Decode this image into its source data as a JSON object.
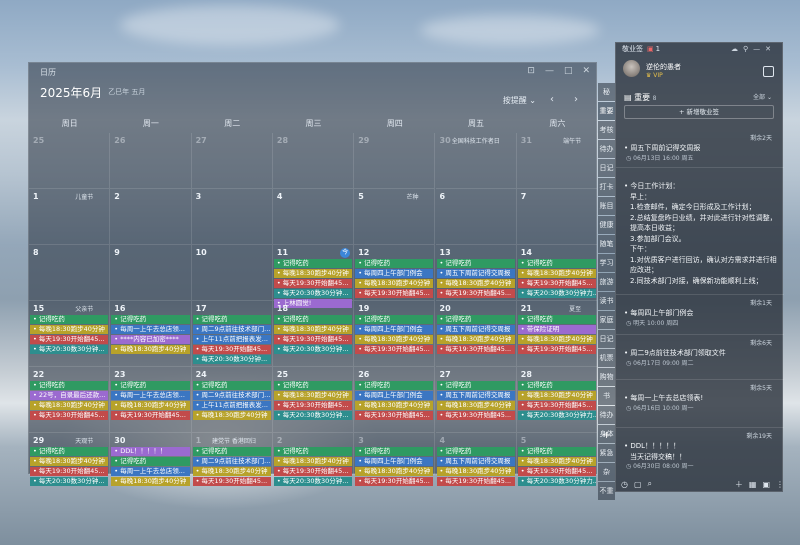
{
  "calendar": {
    "window_title": "日历",
    "month": "2025年6月",
    "lunar": "乙巳年 五月",
    "mode": "按提醒",
    "weekdays": [
      "周日",
      "周一",
      "周二",
      "周三",
      "周四",
      "周五",
      "周六"
    ],
    "rows": [
      {
        "days": [
          {
            "d": "25",
            "dim": true
          },
          {
            "d": "26",
            "dim": true
          },
          {
            "d": "27",
            "dim": true
          },
          {
            "d": "28",
            "dim": true
          },
          {
            "d": "29",
            "dim": true
          },
          {
            "d": "30",
            "dim": true,
            "holiday": "全国科技工作者日"
          },
          {
            "d": "31",
            "dim": true,
            "holiday": "端午节"
          }
        ]
      },
      {
        "days": [
          {
            "d": "1",
            "holiday": "儿童节"
          },
          {
            "d": "2"
          },
          {
            "d": "3"
          },
          {
            "d": "4"
          },
          {
            "d": "5",
            "holiday": "芒种"
          },
          {
            "d": "6"
          },
          {
            "d": "7"
          }
        ]
      },
      {
        "days": [
          {
            "d": "8"
          },
          {
            "d": "9"
          },
          {
            "d": "10"
          },
          {
            "d": "11",
            "today": "今",
            "events": [
              {
                "t": "记得吃药",
                "c": "green"
              },
              {
                "t": "每晚18:30跑步40分钟",
                "c": "yellow"
              },
              {
                "t": "每天19:30开始翻45...",
                "c": "red"
              },
              {
                "t": "每天20:30数30分钟...",
                "c": "teal"
              },
              {
                "t": "上林圆觉!",
                "c": "purple"
              }
            ]
          },
          {
            "d": "12",
            "events": [
              {
                "t": "记得吃药",
                "c": "green"
              },
              {
                "t": "每周四上午部门例会",
                "c": "blue"
              },
              {
                "t": "每晚18:30跑步40分钟",
                "c": "yellow"
              },
              {
                "t": "每天19:30开始翻45...",
                "c": "red"
              }
            ]
          },
          {
            "d": "13",
            "events": [
              {
                "t": "记得吃药",
                "c": "green"
              },
              {
                "t": "周五下周前记得交周报",
                "c": "blue"
              },
              {
                "t": "每晚18:30跑步40分钟",
                "c": "yellow"
              },
              {
                "t": "每天19:30开始翻45...",
                "c": "red"
              }
            ]
          },
          {
            "d": "14",
            "events": [
              {
                "t": "记得吃药",
                "c": "green"
              },
              {
                "t": "每晚18:30跑步40分钟",
                "c": "yellow"
              },
              {
                "t": "每天19:30开始翻45...",
                "c": "red"
              },
              {
                "t": "每天20:30数30分钟力...",
                "c": "teal"
              }
            ]
          }
        ]
      },
      {
        "days": [
          {
            "d": "15",
            "holiday": "父亲节",
            "events": [
              {
                "t": "记得吃药",
                "c": "green"
              },
              {
                "t": "每晚18:30跑步40分钟",
                "c": "yellow"
              },
              {
                "t": "每天19:30开始翻45...",
                "c": "red"
              },
              {
                "t": "每天20:30数30分钟...",
                "c": "teal"
              }
            ]
          },
          {
            "d": "16",
            "events": [
              {
                "t": "记得吃药",
                "c": "green"
              },
              {
                "t": "每周一上午去总店领...",
                "c": "blue"
              },
              {
                "t": "****内容已加密****",
                "c": "purple"
              },
              {
                "t": "每晚18:30跑步40分钟",
                "c": "yellow"
              }
            ]
          },
          {
            "d": "17",
            "events": [
              {
                "t": "记得吃药",
                "c": "green"
              },
              {
                "t": "周二9点前往技术部门...",
                "c": "blue"
              },
              {
                "t": "上午11点前把报表发...",
                "c": "blue"
              },
              {
                "t": "每天19:30开始翻45...",
                "c": "red"
              },
              {
                "t": "每天20:30数30分钟...",
                "c": "teal"
              }
            ]
          },
          {
            "d": "18",
            "events": [
              {
                "t": "记得吃药",
                "c": "green"
              },
              {
                "t": "每晚18:30跑步40分钟",
                "c": "yellow"
              },
              {
                "t": "每天19:30开始翻45...",
                "c": "red"
              },
              {
                "t": "每天20:30数30分钟...",
                "c": "teal"
              }
            ]
          },
          {
            "d": "19",
            "events": [
              {
                "t": "记得吃药",
                "c": "green"
              },
              {
                "t": "每周四上午部门例会",
                "c": "blue"
              },
              {
                "t": "每晚18:30跑步40分钟",
                "c": "yellow"
              },
              {
                "t": "每天19:30开始翻45...",
                "c": "red"
              }
            ]
          },
          {
            "d": "20",
            "events": [
              {
                "t": "记得吃药",
                "c": "green"
              },
              {
                "t": "周五下周前记得交周报",
                "c": "blue"
              },
              {
                "t": "每晚18:30跑步40分钟",
                "c": "yellow"
              },
              {
                "t": "每天19:30开始翻45...",
                "c": "red"
              }
            ]
          },
          {
            "d": "21",
            "holiday": "夏至",
            "events": [
              {
                "t": "记得吃药",
                "c": "green"
              },
              {
                "t": "带保险证明",
                "c": "purple"
              },
              {
                "t": "每晚18:30跑步40分钟",
                "c": "yellow"
              },
              {
                "t": "每天19:30开始翻45...",
                "c": "red"
              }
            ]
          }
        ]
      },
      {
        "days": [
          {
            "d": "22",
            "events": [
              {
                "t": "记得吃药",
                "c": "green"
              },
              {
                "t": "22号，自录最后还款...",
                "c": "purple"
              },
              {
                "t": "每晚18:30跑步40分钟",
                "c": "yellow"
              },
              {
                "t": "每天19:30开始翻45...",
                "c": "red"
              }
            ]
          },
          {
            "d": "23",
            "events": [
              {
                "t": "记得吃药",
                "c": "green"
              },
              {
                "t": "每周一上午去总店领...",
                "c": "blue"
              },
              {
                "t": "每晚18:30跑步40分钟",
                "c": "yellow"
              },
              {
                "t": "每天19:30开始翻45...",
                "c": "red"
              }
            ]
          },
          {
            "d": "24",
            "events": [
              {
                "t": "记得吃药",
                "c": "green"
              },
              {
                "t": "周二9点前往技术部门...",
                "c": "blue"
              },
              {
                "t": "上午11点前把报表发...",
                "c": "blue"
              },
              {
                "t": "每晚18:30跑步40分钟",
                "c": "yellow"
              }
            ]
          },
          {
            "d": "25",
            "events": [
              {
                "t": "记得吃药",
                "c": "green"
              },
              {
                "t": "每晚18:30跑步40分钟",
                "c": "yellow"
              },
              {
                "t": "每天19:30开始翻45...",
                "c": "red"
              },
              {
                "t": "每天20:30数30分钟...",
                "c": "teal"
              }
            ]
          },
          {
            "d": "26",
            "events": [
              {
                "t": "记得吃药",
                "c": "green"
              },
              {
                "t": "每周四上午部门例会",
                "c": "blue"
              },
              {
                "t": "每晚18:30跑步40分钟",
                "c": "yellow"
              },
              {
                "t": "每天19:30开始翻45...",
                "c": "red"
              }
            ]
          },
          {
            "d": "27",
            "events": [
              {
                "t": "记得吃药",
                "c": "green"
              },
              {
                "t": "周五下周前记得交周报",
                "c": "blue"
              },
              {
                "t": "每晚18:30跑步40分钟",
                "c": "yellow"
              },
              {
                "t": "每天19:30开始翻45...",
                "c": "red"
              }
            ]
          },
          {
            "d": "28",
            "events": [
              {
                "t": "记得吃药",
                "c": "green"
              },
              {
                "t": "每晚18:30跑步40分钟",
                "c": "yellow"
              },
              {
                "t": "每天19:30开始翻45...",
                "c": "red"
              },
              {
                "t": "每天20:30数30分钟力...",
                "c": "teal"
              }
            ]
          }
        ]
      },
      {
        "days": [
          {
            "d": "29",
            "holiday": "天观节",
            "events": [
              {
                "t": "记得吃药",
                "c": "green"
              },
              {
                "t": "每晚18:30跑步40分钟",
                "c": "yellow"
              },
              {
                "t": "每天19:30开始翻45...",
                "c": "red"
              },
              {
                "t": "每天20:30数30分钟...",
                "c": "teal"
              }
            ]
          },
          {
            "d": "30",
            "events": [
              {
                "t": "DDL！！！！！",
                "c": "purple"
              },
              {
                "t": "记得吃药",
                "c": "green"
              },
              {
                "t": "每周一上午去总店领...",
                "c": "blue"
              },
              {
                "t": "每晚18:30跑步40分钟",
                "c": "yellow"
              }
            ]
          },
          {
            "d": "1",
            "dim": true,
            "holiday": "建党节 香港回归",
            "events": [
              {
                "t": "记得吃药",
                "c": "green"
              },
              {
                "t": "周二9点前往技术部门...",
                "c": "blue"
              },
              {
                "t": "每晚18:30跑步40分钟",
                "c": "yellow"
              },
              {
                "t": "每天19:30开始翻45...",
                "c": "red"
              }
            ]
          },
          {
            "d": "2",
            "dim": true,
            "events": [
              {
                "t": "记得吃药",
                "c": "green"
              },
              {
                "t": "每晚18:30跑步40分钟",
                "c": "yellow"
              },
              {
                "t": "每天19:30开始翻45...",
                "c": "red"
              },
              {
                "t": "每天20:30数30分钟...",
                "c": "teal"
              }
            ]
          },
          {
            "d": "3",
            "dim": true,
            "events": [
              {
                "t": "记得吃药",
                "c": "green"
              },
              {
                "t": "每周四上午部门例会",
                "c": "blue"
              },
              {
                "t": "每晚18:30跑步40分钟",
                "c": "yellow"
              },
              {
                "t": "每天19:30开始翻45...",
                "c": "red"
              }
            ]
          },
          {
            "d": "4",
            "dim": true,
            "events": [
              {
                "t": "记得吃药",
                "c": "green"
              },
              {
                "t": "周五下周前记得交周报",
                "c": "blue"
              },
              {
                "t": "每晚18:30跑步40分钟",
                "c": "yellow"
              },
              {
                "t": "每天19:30开始翻45...",
                "c": "red"
              }
            ]
          },
          {
            "d": "5",
            "dim": true,
            "events": [
              {
                "t": "记得吃药",
                "c": "green"
              },
              {
                "t": "每晚18:30跑步40分钟",
                "c": "yellow"
              },
              {
                "t": "每天19:30开始翻45...",
                "c": "red"
              },
              {
                "t": "每天20:30数30分钟力...",
                "c": "teal"
              }
            ]
          }
        ]
      }
    ]
  },
  "tabs": [
    "秘",
    "重要",
    "考核",
    "待办",
    "日记",
    "打卡",
    "账目",
    "健康",
    "随笔",
    "学习",
    "旅游",
    "读书",
    "家庭",
    "日记",
    "机票",
    "购物",
    "书",
    "待办",
    "身体",
    "紧急",
    "杂",
    "不重"
  ],
  "memo": {
    "title": "敬业签",
    "count": "1",
    "user": "逆伦的愚者",
    "vip": "VIP",
    "section": "重要",
    "section_count": "8",
    "all": "全部",
    "new": "+ 新增敬业签",
    "notes": [
      {
        "remain": "剩余2天",
        "lines": [
          "周五下周前记得交周报"
        ],
        "time": "06月13日 16:00 周五"
      },
      {
        "remain": "",
        "lines": [
          "今日工作计划：",
          "早上：",
          "1.检查邮件，确定今日形成及工作计划；",
          "2.总结复盘昨日业绩，并对此进行针对性调整，提高本日收益；",
          "3.参加部门会议。",
          "下午：",
          "1.对优质客户进行回访，确认对方需求并进行相应改进；",
          "2.同技术部门对接，确保新功能顺利上线；"
        ],
        "time": ""
      },
      {
        "remain": "剩余1天",
        "lines": [
          "每周四上午部门例会"
        ],
        "time": "明天 10:00 周四"
      },
      {
        "remain": "剩余6天",
        "lines": [
          "周二9点前往技术部门领取文件"
        ],
        "time": "06月17日 09:00 周二"
      },
      {
        "remain": "剩余5天",
        "lines": [
          "每周一上午去总店领表!"
        ],
        "time": "06月16日 10:00 周一"
      },
      {
        "remain": "剩余19天",
        "lines": [
          "DDL！！！！！",
          "当天记得交稿！！"
        ],
        "time": "06月30日 08:00 周一"
      }
    ]
  }
}
